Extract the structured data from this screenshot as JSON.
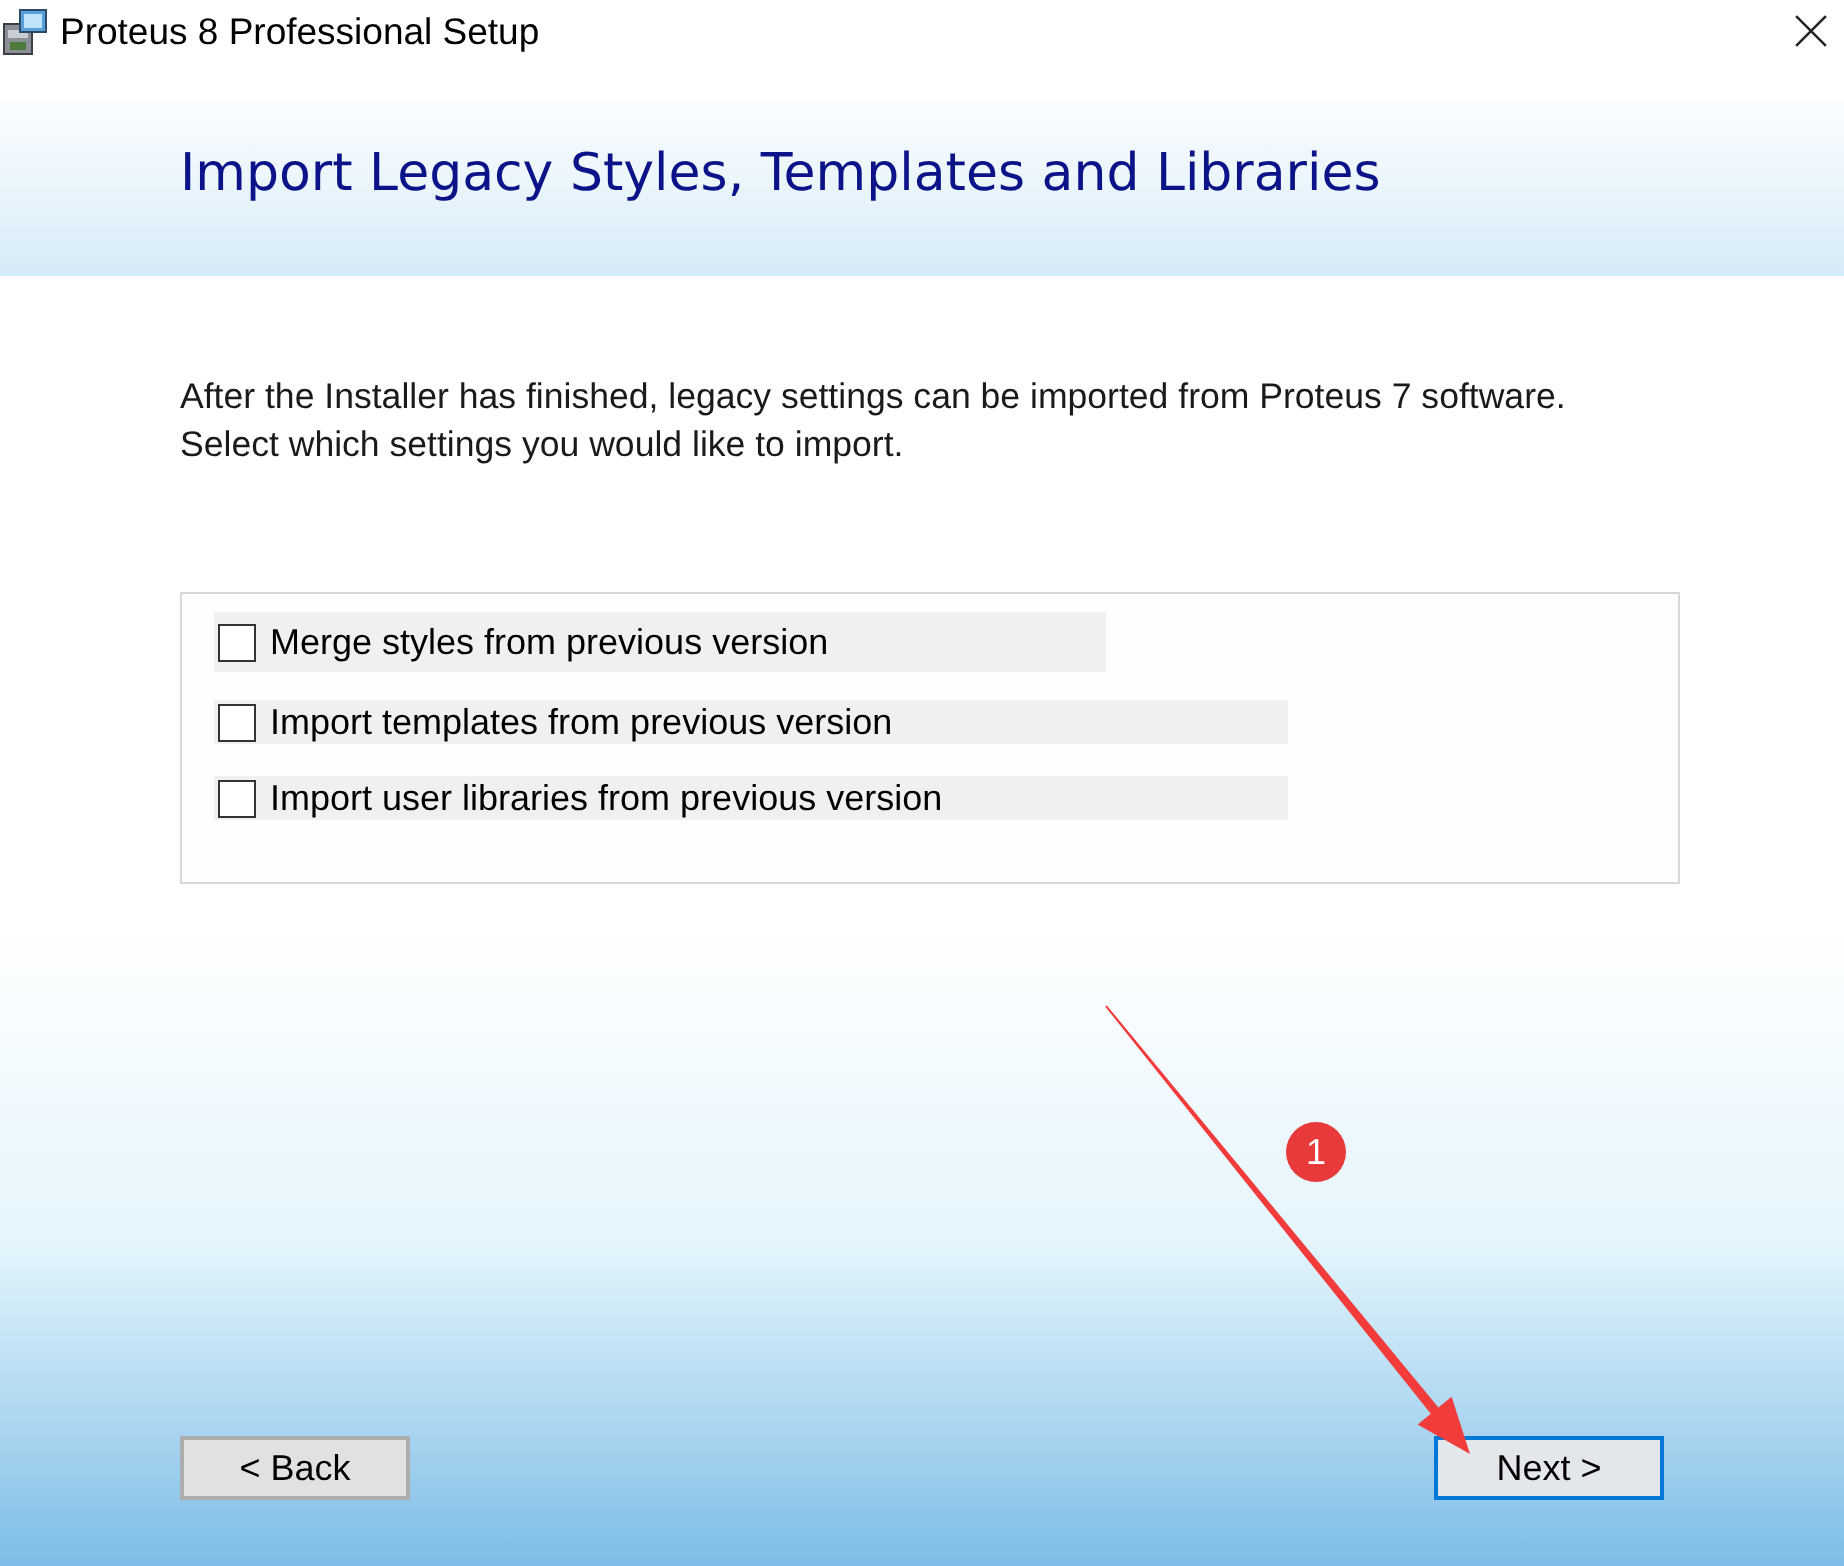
{
  "window": {
    "title": "Proteus 8 Professional Setup"
  },
  "header": {
    "title": "Import Legacy Styles, Templates and Libraries"
  },
  "description": [
    "After the Installer has finished, legacy settings can be imported from Proteus 7 software.",
    "Select which settings you would like to import."
  ],
  "options": [
    {
      "label": "Merge styles from previous version",
      "checked": false
    },
    {
      "label": "Import templates from previous version",
      "checked": false
    },
    {
      "label": "Import user libraries from previous version",
      "checked": false
    }
  ],
  "buttons": [
    {
      "label": "< Back",
      "default": false
    },
    {
      "label": "Next >",
      "default": true
    }
  ],
  "annotation": {
    "badge": "1"
  }
}
